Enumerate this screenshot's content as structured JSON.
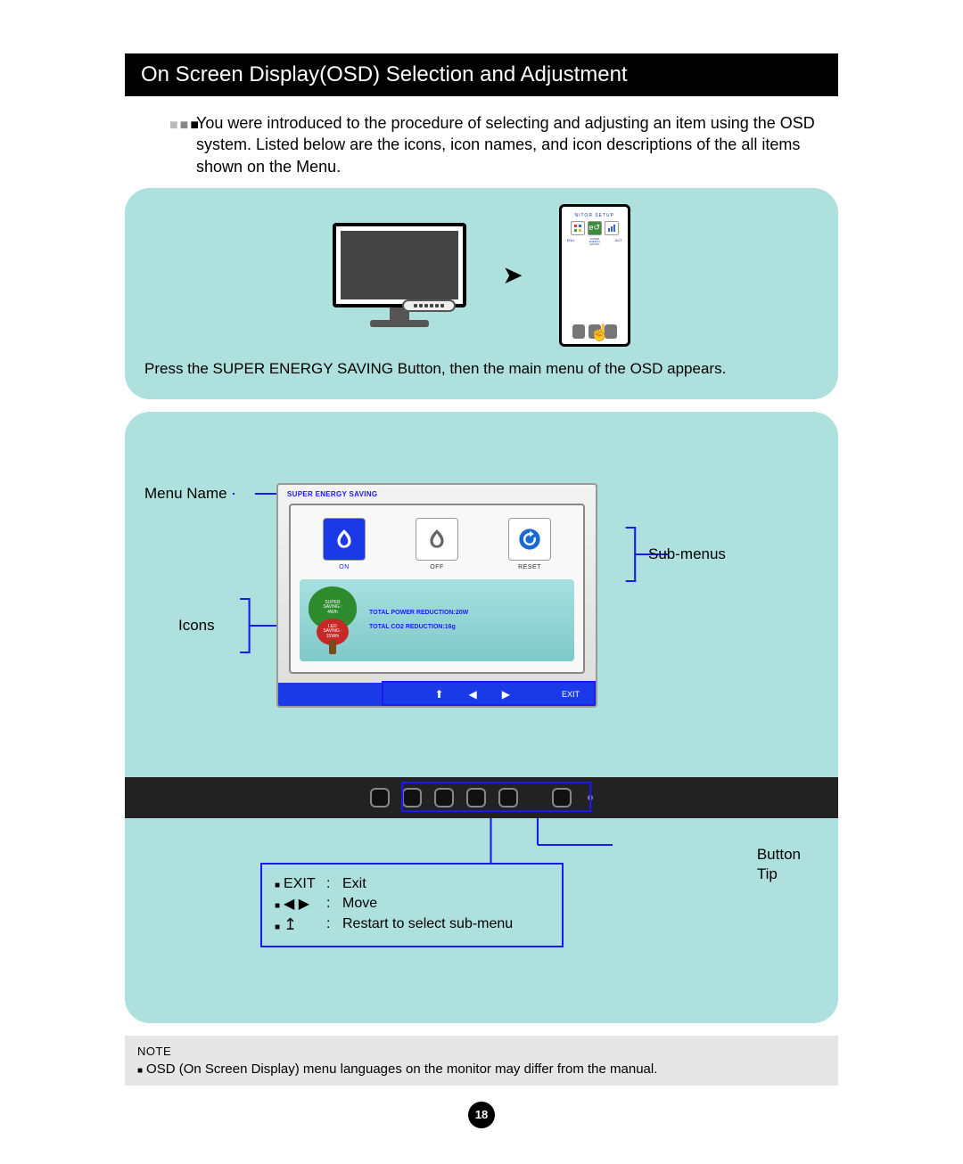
{
  "title": "On Screen Display(OSD) Selection and Adjustment",
  "intro": "You were introduced to the procedure of selecting and adjusting an item using the OSD system. Listed below are the icons, icon names, and icon descriptions of the all items shown on the Menu.",
  "panel1": {
    "phone_header": "NITOR SETUP",
    "phone_labels": {
      "left": "ENU",
      "mid": "SUPER ENERGY SAVING",
      "right": "AUT"
    },
    "caption": "Press the SUPER ENERGY SAVING Button, then the main menu of the OSD appears."
  },
  "panel2": {
    "callouts": {
      "menu_name": "Menu Name",
      "icons": "Icons",
      "sub_menus": "Sub-menus",
      "button_tip": "Button\nTip"
    },
    "osd": {
      "title": "SUPER ENERGY SAVING",
      "options": [
        {
          "label": "ON",
          "active": true,
          "icon": "leaf"
        },
        {
          "label": "OFF",
          "active": false,
          "icon": "leaf-outline"
        },
        {
          "label": "RESET",
          "active": false,
          "icon": "reset"
        }
      ],
      "tree": {
        "super_line1": "SUPER",
        "super_line2": "SAVING :",
        "super_line3": "4W/h",
        "led_line1": "LED",
        "led_line2": "SAVING :",
        "led_line3": "15W/h"
      },
      "stats": {
        "power": "TOTAL POWER REDUCTION:20W",
        "co2": "TOTAL CO2 REDUCTION:16g"
      },
      "nav_exit": "EXIT"
    },
    "legend": [
      {
        "key": "EXIT",
        "desc": "Exit"
      },
      {
        "key": "◀ ▶",
        "desc": "Move"
      },
      {
        "key": "↥",
        "desc": "Restart to select sub-menu"
      }
    ]
  },
  "note": {
    "heading": "NOTE",
    "body": "OSD (On Screen Display) menu languages on the monitor may differ from the manual."
  },
  "page_number": "18"
}
